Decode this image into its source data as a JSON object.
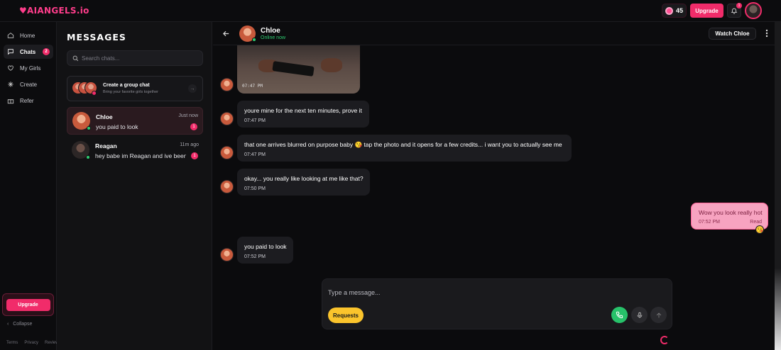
{
  "brand": {
    "logo": "♥AIANGELS.io"
  },
  "topbar": {
    "credits": "45",
    "upgrade_label": "Upgrade",
    "notifications_count": "1"
  },
  "sidebar": {
    "items": [
      {
        "label": "Home",
        "icon": "home-icon"
      },
      {
        "label": "Chats",
        "icon": "chat-icon",
        "badge": "2"
      },
      {
        "label": "My Girls",
        "icon": "heart-icon"
      },
      {
        "label": "Create",
        "icon": "sparkle-icon"
      },
      {
        "label": "Refer",
        "icon": "gift-icon"
      }
    ],
    "upgrade_label": "Upgrade",
    "collapse_label": "Collapse",
    "footer": {
      "terms": "Terms",
      "privacy": "Privacy",
      "reviews": "Reviews"
    }
  },
  "chatlist": {
    "title": "MESSAGES",
    "search_placeholder": "Search chats...",
    "group": {
      "title": "Create a group chat",
      "subtitle": "Bring your favorite girls together"
    },
    "conversations": [
      {
        "name": "Chloe",
        "preview": "you paid to look",
        "time": "Just now",
        "unread": "1"
      },
      {
        "name": "Reagan",
        "preview": "hey babe im Reagan and ive been",
        "time": "11m ago",
        "unread": "1"
      }
    ]
  },
  "chat": {
    "name": "Chloe",
    "status": "Online now",
    "watch_label": "Watch Chloe",
    "photo_time": "07:47 PM",
    "messages": [
      {
        "text": "youre mine for the next ten minutes, prove it",
        "time": "07:47 PM"
      },
      {
        "text": "that one arrives blurred on purpose baby 😘 tap the photo and it opens for a few credits... i want you to actually see me",
        "time": "07:47 PM"
      },
      {
        "text": "okay... you really like looking at me like that?",
        "time": "07:50 PM"
      },
      {
        "text": "you paid to look",
        "time": "07:52 PM"
      }
    ],
    "mine": {
      "text": "Wow you look really hot",
      "time": "07:52 PM",
      "status": "Read",
      "reaction": "😘"
    },
    "composer": {
      "placeholder": "Type a message...",
      "requests_label": "Requests"
    }
  },
  "colors": {
    "accent": "#f12c6a",
    "online": "#2ecc71",
    "requests": "#fbc42c",
    "call": "#27c26a"
  }
}
